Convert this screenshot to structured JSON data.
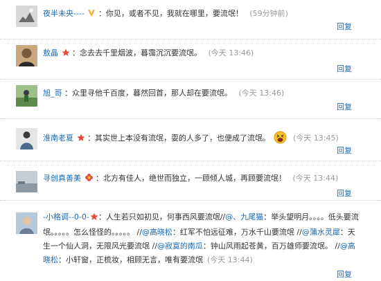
{
  "reply_label": "回复",
  "comments": [
    {
      "user": "夜半未央----",
      "badge": "v-badge-icon",
      "text": "：你见，或者不见，我就在哪里，要流氓！",
      "time": "(59分钟前)"
    },
    {
      "user": "敖晶",
      "badge": "star-badge-icon",
      "text": "：念去去千里烟波，暮霭沉沉要流氓。",
      "time": "(今天 13:46)"
    },
    {
      "user": "旭_哥",
      "text": "：众里寻他千百度，暮然回首，那人却在要流氓。",
      "time": "(今天 13:46)"
    },
    {
      "user": "淮南老夏",
      "badge": "star-badge-icon",
      "text": "：其实世上本没有流氓，耍的人多了，也便成了流氓。",
      "emoji": "laughing-face-icon",
      "time": "(今天 13:45)"
    },
    {
      "user": "寻创真善美",
      "badge": "flower-badge-icon",
      "text": "：北方有佳人，绝世而独立，一顾倾人城，再顾要流氓！",
      "time": "(今天 13:44)"
    },
    {
      "user": "-小格调--0-0-",
      "badge": "star-badge-icon",
      "seg1": "：人生若只如初见，何事西风要流氓",
      "seg2": "//",
      "mention1": "@、九尾猫",
      "seg3": "：举头望明月。。。。低头要流氓。。。。。怎么怪怪的。。。。。",
      "seg4": " //",
      "mention2": "@高晓松",
      "seg5": "：红军不怕远征难，万水千山要流氓 //",
      "mention3": "@蒲水灵犀",
      "seg6": "：天生一个仙人洞，无限风光要流氓 //",
      "mention4": "@寂寞的南瓜",
      "seg7": "：钟山风雨起苍黄，百万雄师要流氓。 //",
      "mention5": "@高晓松",
      "seg8": "：小轩窗，正梳妆，相顾无言，唯有要流氓",
      "time": "(今天 13:44)"
    }
  ]
}
